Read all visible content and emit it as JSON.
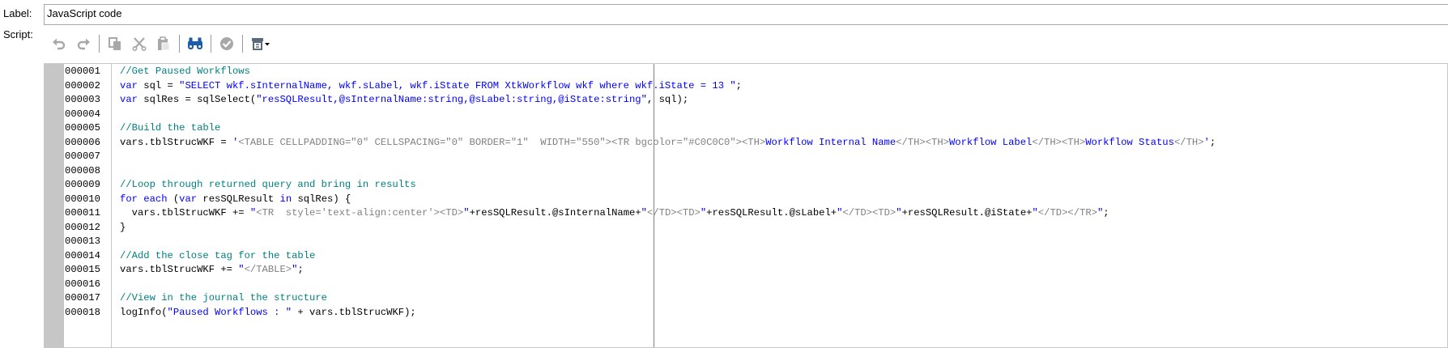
{
  "label_row": {
    "label": "Label:",
    "value": "JavaScript code"
  },
  "script_row": {
    "label": "Script:"
  },
  "toolbar": [
    {
      "name": "undo-button",
      "icon": "undo-icon",
      "enabled": false
    },
    {
      "name": "redo-button",
      "icon": "redo-icon",
      "enabled": false
    },
    {
      "sep": true
    },
    {
      "name": "copy-button",
      "icon": "copy-icon",
      "enabled": false
    },
    {
      "name": "cut-button",
      "icon": "cut-icon",
      "enabled": false
    },
    {
      "name": "paste-button",
      "icon": "paste-icon",
      "enabled": false
    },
    {
      "sep": true
    },
    {
      "name": "find-button",
      "icon": "binoculars-icon",
      "enabled": true
    },
    {
      "sep": true
    },
    {
      "name": "check-syntax-button",
      "icon": "check-icon",
      "enabled": false
    },
    {
      "sep": true
    },
    {
      "name": "insert-menu-button",
      "icon": "insert-dropdown-icon",
      "enabled": true
    }
  ],
  "colors": {
    "comment": "#008080",
    "keyword": "#0000ff",
    "string": "#0000ff",
    "plain": "#000000",
    "tag": "#808080",
    "gutter": "#c6c6c6",
    "disabled_icon": "#a8a8a8",
    "binoculars_icon": "#1d5aa8"
  },
  "code_lines": [
    {
      "num": "000001",
      "tokens": [
        {
          "t": "comment",
          "v": "//Get Paused Workflows"
        }
      ]
    },
    {
      "num": "000002",
      "tokens": [
        {
          "t": "keyword",
          "v": "var"
        },
        {
          "t": "plain",
          "v": " sql = "
        },
        {
          "t": "string",
          "v": "\"SELECT wkf.sInternalName, wkf.sLabel, wkf.iState FROM XtkWorkflow wkf where wkf.iState = 13 \""
        },
        {
          "t": "plain",
          "v": ";"
        }
      ]
    },
    {
      "num": "000003",
      "tokens": [
        {
          "t": "keyword",
          "v": "var"
        },
        {
          "t": "plain",
          "v": " sqlRes = sqlSelect("
        },
        {
          "t": "string",
          "v": "\"resSQLResult,@sInternalName:string,@sLabel:string,@iState:string\""
        },
        {
          "t": "plain",
          "v": ", sql);"
        }
      ]
    },
    {
      "num": "000004",
      "tokens": []
    },
    {
      "num": "000005",
      "tokens": [
        {
          "t": "comment",
          "v": "//Build the table"
        }
      ]
    },
    {
      "num": "000006",
      "tokens": [
        {
          "t": "plain",
          "v": "vars.tblStrucWKF = "
        },
        {
          "t": "string",
          "v": "'"
        },
        {
          "t": "tag",
          "v": "<TABLE CELLPADDING=\"0\" CELLSPACING=\"0\" BORDER=\"1\"  WIDTH=\"550\">"
        },
        {
          "t": "tag",
          "v": "<TR bgcolor=\"#C0C0C0\">"
        },
        {
          "t": "tag",
          "v": "<TH>"
        },
        {
          "t": "string",
          "v": "Workflow Internal Name"
        },
        {
          "t": "tag",
          "v": "</TH>"
        },
        {
          "t": "tag",
          "v": "<TH>"
        },
        {
          "t": "string",
          "v": "Workflow Label"
        },
        {
          "t": "tag",
          "v": "</TH>"
        },
        {
          "t": "tag",
          "v": "<TH>"
        },
        {
          "t": "string",
          "v": "Workflow Status"
        },
        {
          "t": "tag",
          "v": "</TH>"
        },
        {
          "t": "string",
          "v": "'"
        },
        {
          "t": "plain",
          "v": ";"
        }
      ]
    },
    {
      "num": "000007",
      "tokens": []
    },
    {
      "num": "000008",
      "tokens": []
    },
    {
      "num": "000009",
      "tokens": [
        {
          "t": "comment",
          "v": "//Loop through returned query and bring in results"
        }
      ]
    },
    {
      "num": "000010",
      "tokens": [
        {
          "t": "keyword",
          "v": "for each"
        },
        {
          "t": "plain",
          "v": " ("
        },
        {
          "t": "keyword",
          "v": "var"
        },
        {
          "t": "plain",
          "v": " resSQLResult "
        },
        {
          "t": "keyword",
          "v": "in"
        },
        {
          "t": "plain",
          "v": " sqlRes) {"
        }
      ]
    },
    {
      "num": "000011",
      "tokens": [
        {
          "t": "plain",
          "v": "  vars.tblStrucWKF += "
        },
        {
          "t": "string",
          "v": "\""
        },
        {
          "t": "tag",
          "v": "<TR  style='text-align:center'>"
        },
        {
          "t": "tag",
          "v": "<TD>"
        },
        {
          "t": "string",
          "v": "\""
        },
        {
          "t": "plain",
          "v": "+resSQLResult.@sInternalName+"
        },
        {
          "t": "string",
          "v": "\""
        },
        {
          "t": "tag",
          "v": "</TD>"
        },
        {
          "t": "tag",
          "v": "<TD>"
        },
        {
          "t": "string",
          "v": "\""
        },
        {
          "t": "plain",
          "v": "+resSQLResult.@sLabel+"
        },
        {
          "t": "string",
          "v": "\""
        },
        {
          "t": "tag",
          "v": "</TD>"
        },
        {
          "t": "tag",
          "v": "<TD>"
        },
        {
          "t": "string",
          "v": "\""
        },
        {
          "t": "plain",
          "v": "+resSQLResult.@iState+"
        },
        {
          "t": "string",
          "v": "\""
        },
        {
          "t": "tag",
          "v": "</TD>"
        },
        {
          "t": "tag",
          "v": "</TR>"
        },
        {
          "t": "string",
          "v": "\""
        },
        {
          "t": "plain",
          "v": ";"
        }
      ]
    },
    {
      "num": "000012",
      "tokens": [
        {
          "t": "plain",
          "v": "}"
        }
      ]
    },
    {
      "num": "000013",
      "tokens": []
    },
    {
      "num": "000014",
      "tokens": [
        {
          "t": "comment",
          "v": "//Add the close tag for the table"
        }
      ]
    },
    {
      "num": "000015",
      "tokens": [
        {
          "t": "plain",
          "v": "vars.tblStrucWKF += "
        },
        {
          "t": "string",
          "v": "\""
        },
        {
          "t": "tag",
          "v": "</TABLE>"
        },
        {
          "t": "string",
          "v": "\""
        },
        {
          "t": "plain",
          "v": ";"
        }
      ]
    },
    {
      "num": "000016",
      "tokens": []
    },
    {
      "num": "000017",
      "tokens": [
        {
          "t": "comment",
          "v": "//View in the journal the structure"
        }
      ]
    },
    {
      "num": "000018",
      "tokens": [
        {
          "t": "plain",
          "v": "logInfo("
        },
        {
          "t": "string",
          "v": "\"Paused Workflows : \""
        },
        {
          "t": "plain",
          "v": " + vars.tblStrucWKF);"
        }
      ]
    }
  ]
}
